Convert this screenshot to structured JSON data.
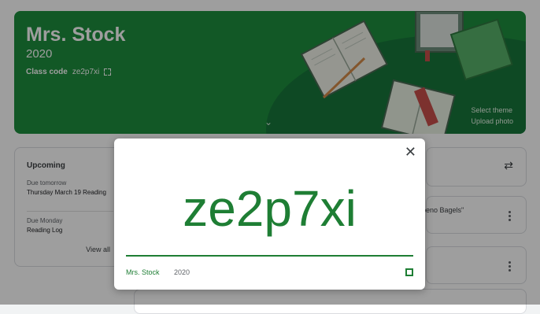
{
  "banner": {
    "class_name": "Mrs. Stock",
    "year": "2020",
    "class_code_label": "Class code",
    "class_code": "ze2p7xi",
    "select_theme": "Select theme",
    "upload_photo": "Upload photo"
  },
  "upcoming": {
    "title": "Upcoming",
    "items": [
      {
        "due": "Due tomorrow",
        "task": "Thursday March 19 Reading"
      },
      {
        "due": "Due Monday",
        "task": "Reading Log"
      }
    ],
    "view_all": "View all"
  },
  "stream": {
    "post_text": "peno Bagels\""
  },
  "modal": {
    "code": "ze2p7xi",
    "class_name": "Mrs. Stock",
    "year": "2020"
  },
  "colors": {
    "banner_green": "#1e8e3e",
    "code_green": "#1e7e34"
  }
}
